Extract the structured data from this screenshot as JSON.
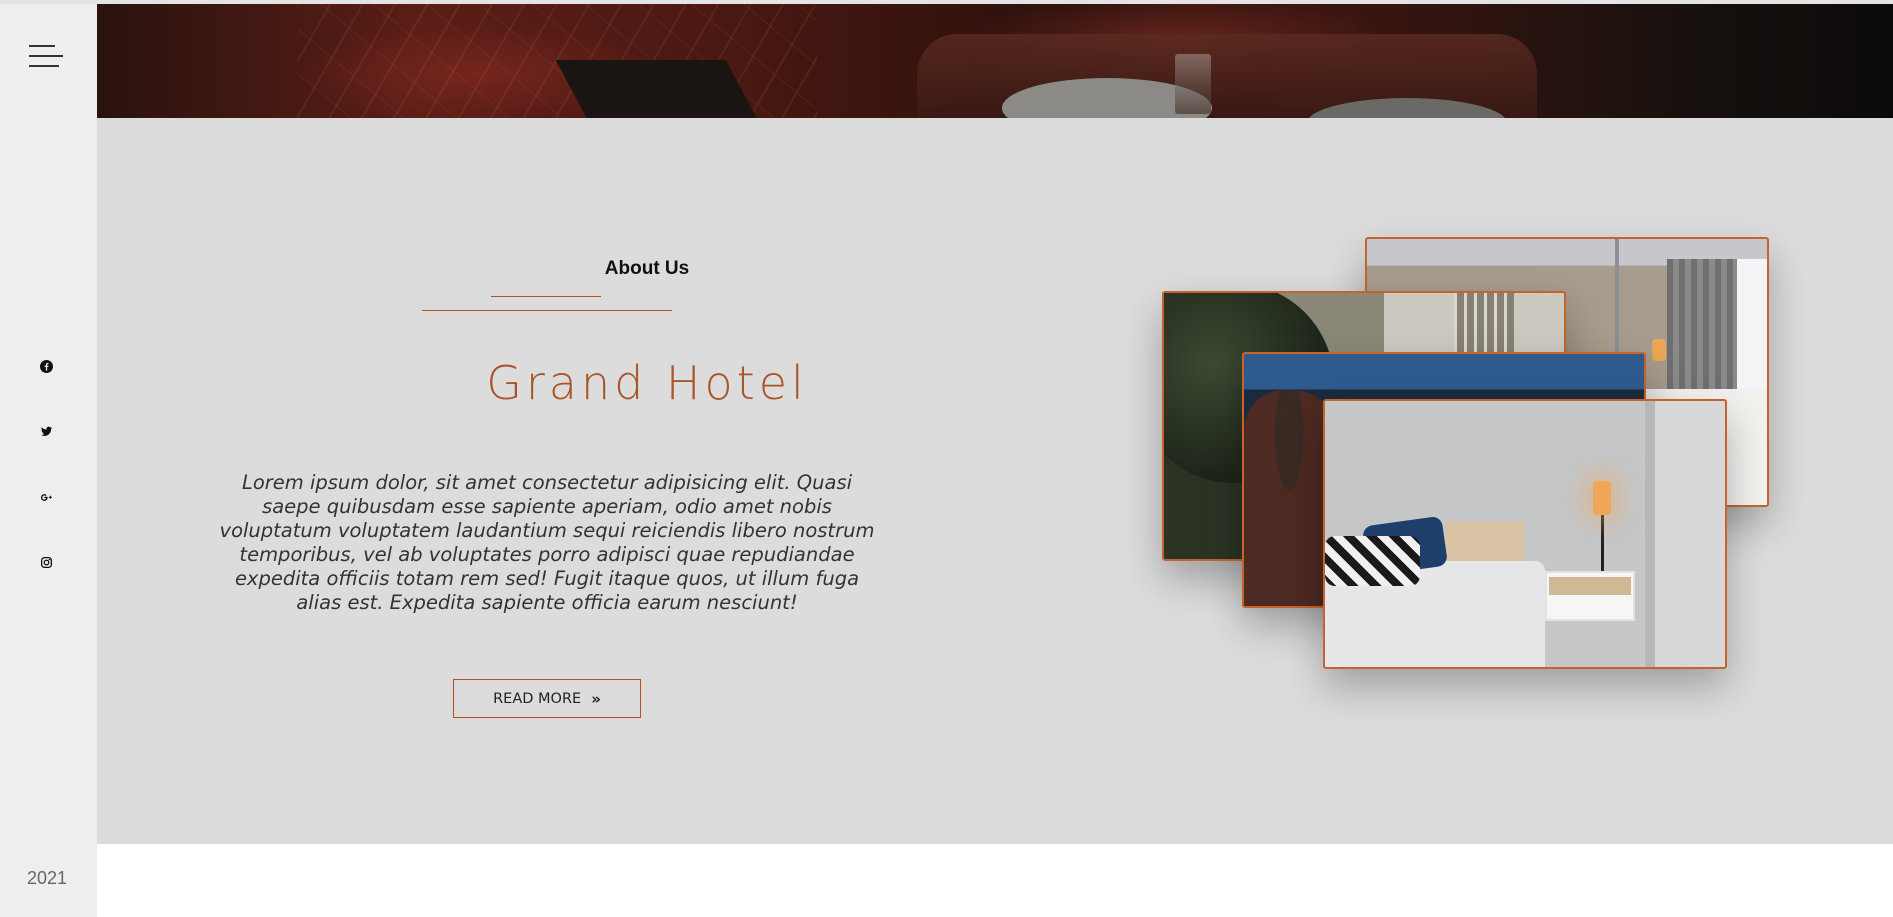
{
  "sidebar": {
    "menu_icon": "hamburger-menu-icon",
    "social": [
      {
        "name": "facebook",
        "icon": "facebook-icon"
      },
      {
        "name": "twitter",
        "icon": "twitter-icon"
      },
      {
        "name": "google-plus",
        "icon": "google-plus-icon"
      },
      {
        "name": "instagram",
        "icon": "instagram-icon"
      }
    ],
    "year": "2021"
  },
  "about": {
    "label": "About Us",
    "title": "Grand Hotel",
    "description": "Lorem ipsum dolor, sit amet consectetur adipisicing elit. Quasi saepe quibusdam esse sapiente aperiam, odio amet nobis voluptatum voluptatem laudantium sequi reiciendis libero nostrum temporibus, vel ab voluptates porro adipisci quae repudiandae expedita officiis totam rem sed! Fugit itaque quos, ut illum fuga alias est. Expedita sapiente officia earum nesciunt!",
    "read_more_label": "READ MORE",
    "read_more_icon": "double-chevron-right-icon"
  },
  "colors": {
    "accent": "#b5531f",
    "title": "#a9552a",
    "section_bg": "#dcdcdc",
    "sidebar_bg": "#eeeeee"
  }
}
